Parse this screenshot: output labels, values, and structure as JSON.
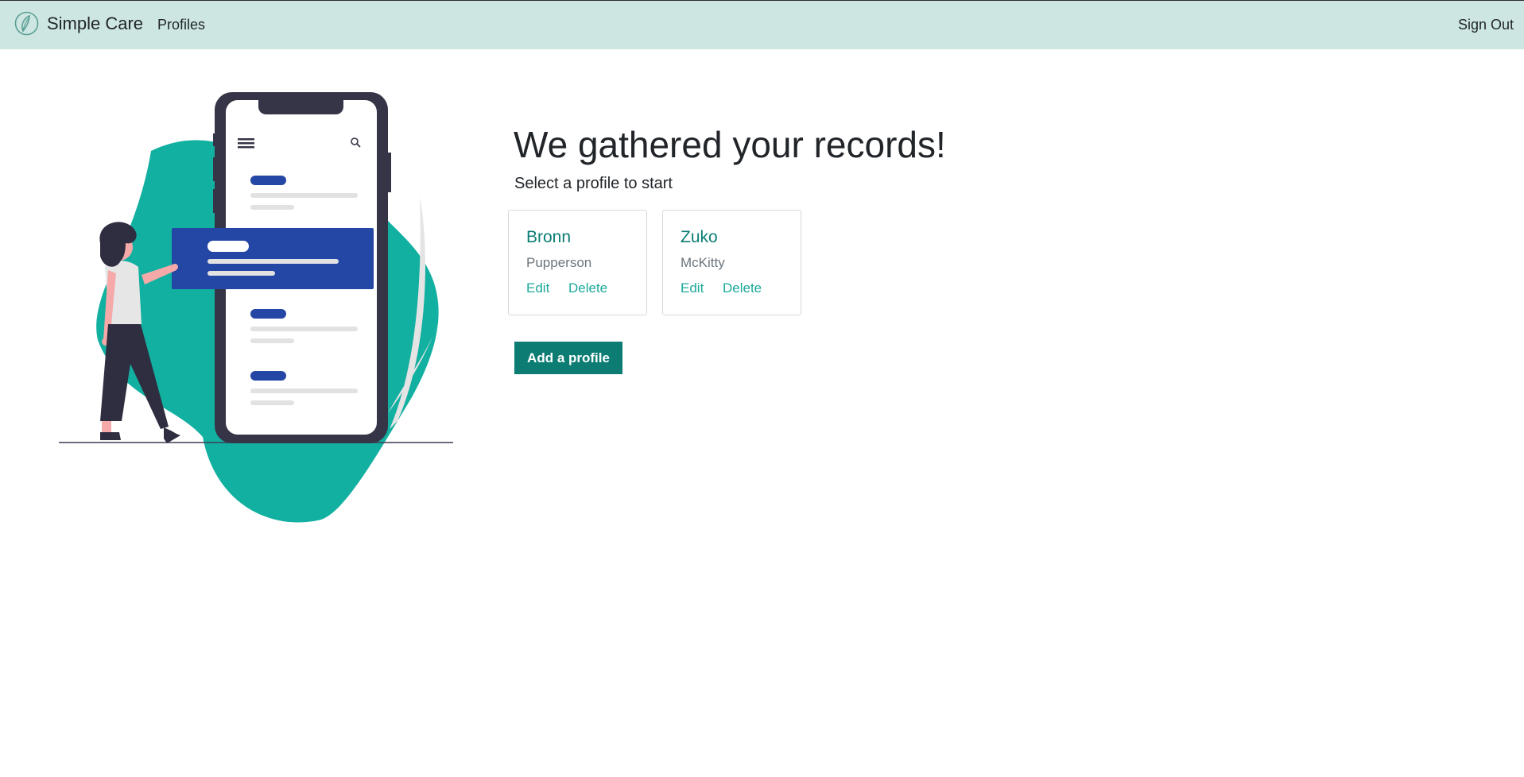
{
  "navbar": {
    "brand_name": "Simple Care",
    "profiles_link": "Profiles",
    "signout_link": "Sign Out",
    "logo_icon": "leaf-logo-icon",
    "background_color": "#cde6e2"
  },
  "main": {
    "title": "We gathered your records!",
    "subtitle": "Select a profile to start",
    "profiles": [
      {
        "first_name": "Bronn",
        "last_name": "Pupperson",
        "edit_label": "Edit",
        "delete_label": "Delete"
      },
      {
        "first_name": "Zuko",
        "last_name": "McKitty",
        "edit_label": "Edit",
        "delete_label": "Delete"
      }
    ],
    "add_button_label": "Add a profile"
  },
  "colors": {
    "accent": "#0d7d74",
    "link": "#1aa89a",
    "illustration_blob": "#12b0a1",
    "illustration_card": "#2446a4",
    "phone_frame": "#363547"
  }
}
